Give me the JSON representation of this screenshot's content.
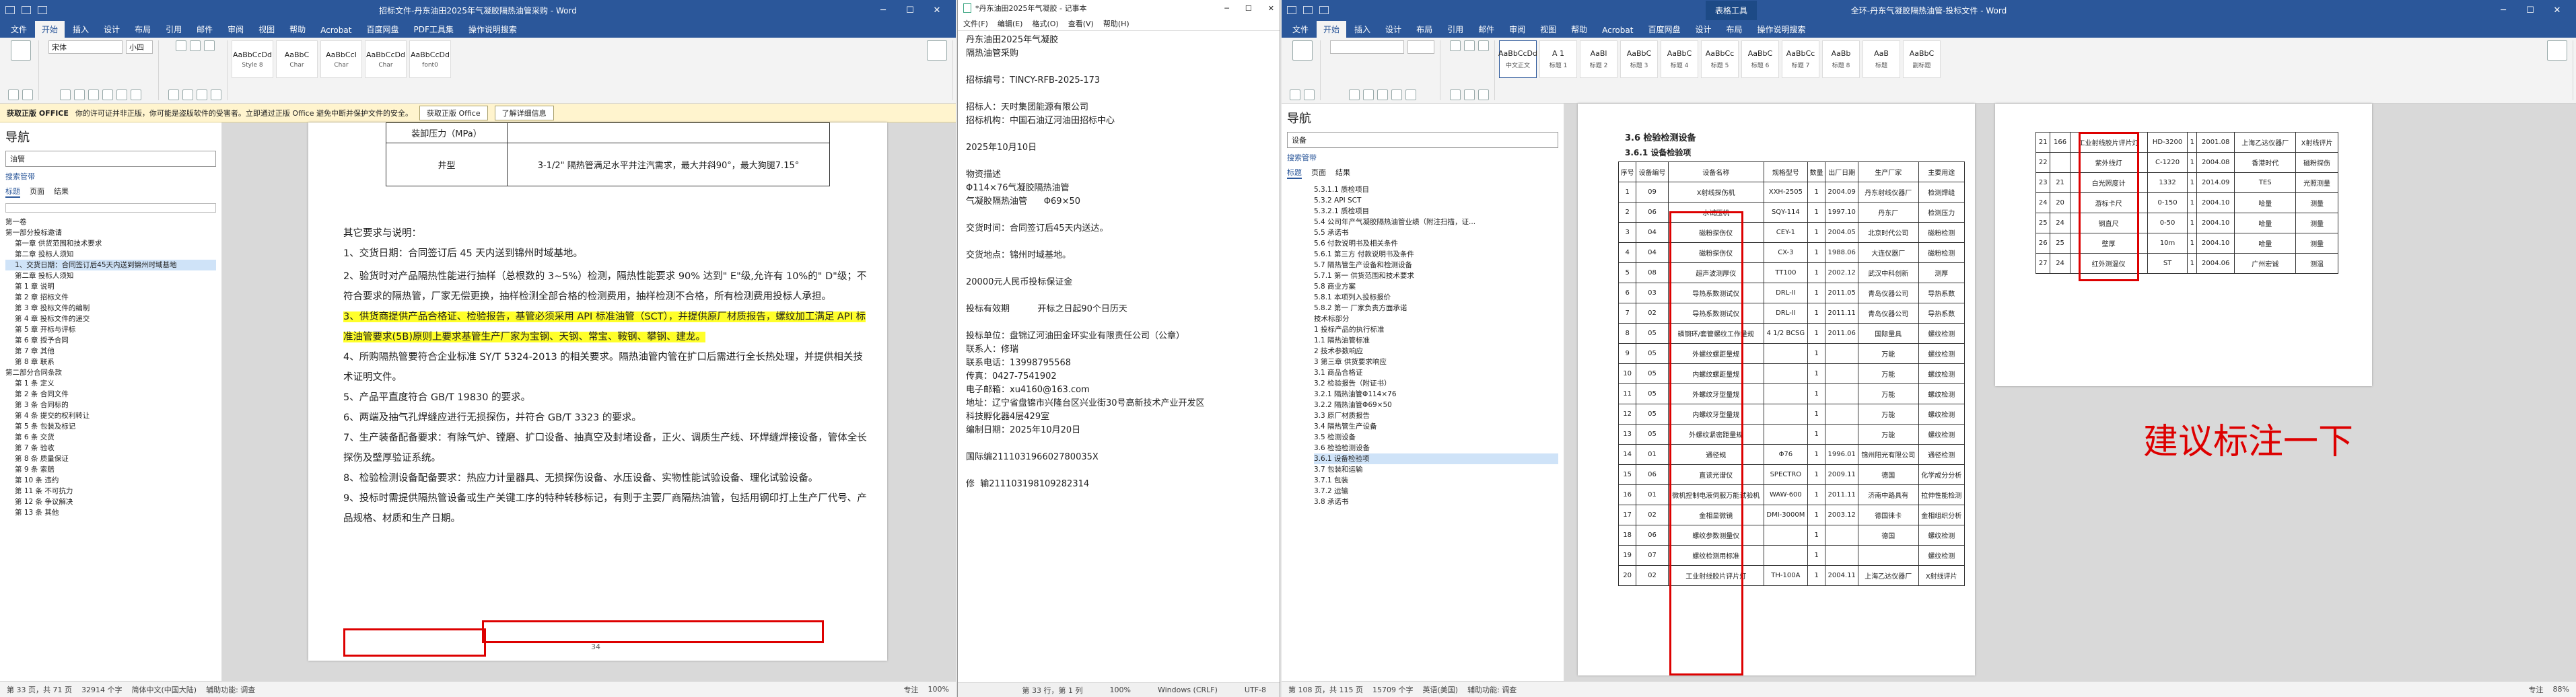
{
  "win1": {
    "title": "招标文件-丹东油田2025年气凝胶隔热油管采购 - Word",
    "tabs": [
      "文件",
      "开始",
      "插入",
      "设计",
      "布局",
      "引用",
      "邮件",
      "审阅",
      "视图",
      "帮助",
      "Acrobat",
      "百度网盘",
      "PDF工具集",
      "操作说明搜索"
    ],
    "font_name": "宋体",
    "font_size": "小四",
    "styles": [
      {
        "preview": "AaBbCcDd",
        "name": "Style 8"
      },
      {
        "preview": "AaBbC",
        "name": "Char"
      },
      {
        "preview": "AaBbCcI",
        "name": "Char"
      },
      {
        "preview": "AaBbCcDd",
        "name": "Char"
      },
      {
        "preview": "AaBbCcDd",
        "name": "font0"
      }
    ],
    "info_title": "获取正版 OFFICE",
    "info_text": "你的许可证并非正版，你可能是盗版软件的受害者。立即通过正版 Office 避免中断并保护文件的安全。",
    "info_btn1": "获取正版 Office",
    "info_btn2": "了解详细信息",
    "nav_title": "导航",
    "nav_search": "油管",
    "nav_result": "搜索管带",
    "nav_tabs": [
      "标题",
      "页面",
      "结果"
    ],
    "nav_items": [
      "第一卷",
      "第一部分投标邀请",
      "第一章 供货范围和技术要求",
      "第二章 投标人须知",
      "1、交货日期：合同签订后45天内送到锦州时域基地",
      "第二章 投标人须知",
      "第 1 章 说明",
      "第 2 章 招标文件",
      "第 3 章 投标文件的编制",
      "第 4 章 投标文件的递交",
      "第 5 章 开标与评标",
      "第 6 章 授予合同",
      "第 7 章 其他",
      "第 8 章 联系",
      "第二部分合同条款",
      "第 1 条 定义",
      "第 2 条 合同文件",
      "第 3 条 合同标的",
      "第 4 条 提交的权利转让",
      "第 5 条 包装及标记",
      "第 6 条 交货",
      "第 7 条 验收",
      "第 8 条 质量保证",
      "第 9 条 索赔",
      "第 10 条 违约",
      "第 11 条 不可抗力",
      "第 12 条 争议解决",
      "第 13 条 其他"
    ],
    "table_rows": [
      [
        "装卸压力（MPa）",
        ""
      ],
      [
        "井型",
        "3-1/2\" 隔热管满足水平井注汽需求，最大井斜90°，最大狗腿7.15°"
      ]
    ],
    "para_intro": "其它要求与说明：",
    "para1": "1、交货日期：合同签订后 45 天内送到锦州时域基地。",
    "para2": "2、验货时对产品隔热性能进行抽样（总根数的 3~5%）检测，隔热性能要求 90% 达到\" E\"级,允许有 10%的\" D\"级；不符合要求的隔热管，厂家无偿更换，抽样检测全部合格的检测费用，抽样检测不合格，所有检测费用投标人承担。",
    "para3": "3、供货商提供产品合格证、检验报告，基管必须采用 API 标准油管（SCT），并提供原厂材质报告，螺纹加工满足 API 标准油管要求(5B)原则上要求基管生产厂家为宝钢、天钢、常宝、鞍钢、攀钢、建龙。",
    "para4": "4、所购隔热管要符合企业标准 SY/T 5324-2013 的相关要求。隔热油管内管在扩口后需进行全长热处理，并提供相关技术证明文件。",
    "para5": "5、产品平直度符合 GB/T 19830 的要求。",
    "para6": "6、两端及抽气孔焊缝应进行无损探伤，并符合 GB/T 3323 的要求。",
    "para7": "7、生产装备配备要求：有除气炉、镗磨、扩口设备、抽真空及封堵设备，正火、调质生产线、环焊缝焊接设备，管体全长探伤及壁厚验证系统。",
    "para8": "8、检验检测设备配备要求：热应力计量器具、无损探伤设备、水压设备、实物性能试验设备、理化试验设备。",
    "para9": "9、投标时需提供隔热管设备或生产关键工序的特种转移标记，有则于主要厂商隔热油管，包括用钢印打上生产厂代号、产品规格、材质和生产日期。",
    "page_no": "34",
    "status": [
      "第 33 页，共 71 页",
      "32914 个字",
      "简体中文(中国大陆)",
      "辅助功能: 调查",
      "专注",
      "100%"
    ]
  },
  "notepad": {
    "title": "*丹东油田2025年气凝胶 - 记事本",
    "menu": [
      "文件(F)",
      "编辑(E)",
      "格式(O)",
      "查看(V)",
      "帮助(H)"
    ],
    "lines": [
      "丹东油田2025年气凝胶",
      "隔热油管采购",
      "",
      "招标编号：TINCY-RFB-2025-173",
      "",
      "招标人：天时集团能源有限公司",
      "招标机构：中国石油辽河油田招标中心",
      "",
      "2025年10月10日",
      "",
      "物资描述",
      "Φ114×76气凝胶隔热油管",
      "气凝胶隔热油管      Φ69×50",
      "",
      "交货时间：合同签订后45天内送达。",
      "",
      "交货地点：锦州时域基地。",
      "",
      "20000元人民币投标保证金",
      "",
      "投标有效期          开标之日起90个日历天",
      "",
      "投标单位：盘锦辽河油田金环实业有限责任公司（公章）",
      "联系人：修瑞",
      "联系电话：13998795568",
      "传真：0427-7541902",
      "电子邮箱：xu4160@163.com",
      "地址：辽宁省盘锦市兴隆台区兴业街30号高新技术产业开发区",
      "科技孵化器4层429室",
      "编制日期：2025年10月20日",
      "",
      "国际编211103196602780035X",
      "",
      "修  输211103198109282314"
    ],
    "status": [
      "第 33 行，第 1 列",
      "100%",
      "Windows (CRLF)",
      "UTF-8"
    ]
  },
  "win3": {
    "title": "全环-丹东气凝胶隔热油管-投标文件 - Word",
    "ctx_tab": "表格工具",
    "tabs": [
      "文件",
      "开始",
      "插入",
      "设计",
      "布局",
      "引用",
      "邮件",
      "审阅",
      "视图",
      "帮助",
      "Acrobat",
      "百度网盘",
      "设计",
      "布局",
      "操作说明搜索"
    ],
    "styles": [
      {
        "preview": "AaBbCcDd",
        "name": "中文正文"
      },
      {
        "preview": "A 1",
        "name": "标题 1"
      },
      {
        "preview": "AaBl",
        "name": "标题 2"
      },
      {
        "preview": "AaBbC",
        "name": "标题 3"
      },
      {
        "preview": "AaBbC",
        "name": "标题 4"
      },
      {
        "preview": "AaBbCc",
        "name": "标题 5"
      },
      {
        "preview": "AaBbC",
        "name": "标题 6"
      },
      {
        "preview": "AaBbCc",
        "name": "标题 7"
      },
      {
        "preview": "AaBb",
        "name": "标题 8"
      },
      {
        "preview": "AaB",
        "name": "标题"
      },
      {
        "preview": "AaBbC",
        "name": "副标题"
      }
    ],
    "nav_title": "导航",
    "nav_search": "设备",
    "nav_result": "搜索管带",
    "nav_tabs": [
      "标题",
      "页面",
      "结果"
    ],
    "nav_items": [
      "5.3.1.1 质检项目",
      "5.3.2 API SCT",
      "5.3.2.1 质检项目",
      "5.4 公司年产气凝胶隔热油管业绩（附注扫描，证...",
      "5.5 承诺书",
      "5.6 付款说明书及相关条件",
      "5.6.1 第三方 付款说明书及条件",
      "5.7 隔热管生产设备和检测设备",
      "5.7.1 第一 供货范围和技术要求",
      "5.8 商业方案",
      "5.8.1 本项列入投标报价",
      "5.8.2 第一 厂家负责方面承诺",
      "技术标部分",
      "1 投标产品的执行标准",
      "1.1 隔热油管标准",
      "2 技术参数响应",
      "3 第三章 供货要求响应",
      "3.1 商品合格证",
      "3.2 检验报告（附证书）",
      "3.2.1 隔热油管Φ114×76",
      "3.2.2 隔热油管Φ69×50",
      "3.3 原厂材质报告",
      "3.4 隔热管生产设备",
      "3.5 检测设备",
      "3.6 检验检测设备",
      "3.6.1 设备检验项",
      "3.7 包装和运输",
      "3.7.1 包装",
      "3.7.2 运输",
      "3.8 承诺书"
    ],
    "heading_main": "3.6 检验检测设备",
    "heading_sub": "3.6.1 设备检验项",
    "table_headers": [
      "序号",
      "设备编号",
      "设备名称",
      "规格型号",
      "数量",
      "出厂日期",
      "生产厂家",
      "主要用途"
    ],
    "table_rows": [
      [
        "1",
        "09",
        "X射线探伤机",
        "XXH-2505",
        "1",
        "2004.09",
        "丹东射线仪器厂",
        "检测焊缝"
      ],
      [
        "2",
        "06",
        "水试压机",
        "SQY-114",
        "1",
        "1997.10",
        "丹东厂",
        "检测压力"
      ],
      [
        "3",
        "04",
        "磁粉探伤仪",
        "CEY-1",
        "1",
        "2004.05",
        "北京时代公司",
        "磁粉检测"
      ],
      [
        "4",
        "04",
        "磁粉探伤仪",
        "CX-3",
        "1",
        "1988.06",
        "大连仪器厂",
        "磁粉检测"
      ],
      [
        "5",
        "08",
        "超声波测厚仪",
        "TT100",
        "1",
        "2002.12",
        "武汉中科创新",
        "测厚"
      ],
      [
        "6",
        "03",
        "导热系数测试仪",
        "DRL-II",
        "1",
        "2011.05",
        "青岛仪器公司",
        "导热系数"
      ],
      [
        "7",
        "02",
        "导热系数测试仪",
        "DRL-II",
        "1",
        "2011.11",
        "青岛仪器公司",
        "导热系数"
      ],
      [
        "8",
        "05",
        "磷钢环/套管螺纹工作量规",
        "4 1/2 BCSG",
        "1",
        "2011.06",
        "国际量具",
        "螺纹检测"
      ],
      [
        "9",
        "05",
        "外螺纹螺距量规",
        "",
        "1",
        "",
        "万能",
        "螺纹检测"
      ],
      [
        "10",
        "05",
        "内螺纹螺距量规",
        "",
        "1",
        "",
        "万能",
        "螺纹检测"
      ],
      [
        "11",
        "05",
        "外螺纹牙型量规",
        "",
        "1",
        "",
        "万能",
        "螺纹检测"
      ],
      [
        "12",
        "05",
        "内螺纹牙型量规",
        "",
        "1",
        "",
        "万能",
        "螺纹检测"
      ],
      [
        "13",
        "05",
        "外螺纹紧密距量规",
        "",
        "1",
        "",
        "万能",
        "螺纹检测"
      ],
      [
        "14",
        "01",
        "通径规",
        "Φ76",
        "1",
        "1996.01",
        "锦州阳光有限公司",
        "通径检测"
      ],
      [
        "15",
        "06",
        "直读光谱仪",
        "SPECTRO",
        "1",
        "2009.11",
        "德国",
        "化学成分分析"
      ],
      [
        "16",
        "01",
        "微机控制电液伺服万能试验机",
        "WAW-600",
        "1",
        "2011.11",
        "济南中路具有",
        "拉伸性能检测"
      ],
      [
        "17",
        "02",
        "金相显微镜",
        "DMI-3000M",
        "1",
        "2003.12",
        "德国徕卡",
        "金相组织分析"
      ],
      [
        "18",
        "06",
        "螺纹参数测量仪",
        "",
        "1",
        "",
        "德国",
        "螺纹检测"
      ],
      [
        "19",
        "07",
        "螺纹检测用标准",
        "",
        "1",
        "",
        "",
        "螺纹检测"
      ],
      [
        "20",
        "02",
        "工业射线胶片评片灯",
        "TH-100A",
        "1",
        "2004.11",
        "上海乙达仪器厂",
        "X射线评片"
      ]
    ],
    "table2_rows": [
      [
        "21",
        "166",
        "工业射线胶片评片灯",
        "HD-3200",
        "1",
        "2001.08",
        "上海乙达仪器厂",
        "X射线评片"
      ],
      [
        "22",
        "",
        "紫外线灯",
        "C-1220",
        "1",
        "2004.08",
        "香港时代",
        "磁粉探伤"
      ],
      [
        "23",
        "21",
        "白光照度计",
        "1332",
        "1",
        "2014.09",
        "TES",
        "光照测量"
      ],
      [
        "24",
        "20",
        "游标卡尺",
        "0-150",
        "1",
        "2004.10",
        "哈量",
        "测量"
      ],
      [
        "25",
        "24",
        "钢直尺",
        "0-50",
        "1",
        "2004.10",
        "哈量",
        "测量"
      ],
      [
        "26",
        "25",
        "壁厚",
        "10m",
        "1",
        "2004.10",
        "哈量",
        "测量"
      ],
      [
        "27",
        "24",
        "红外测温仪",
        "ST",
        "1",
        "2004.06",
        "广州宏诚",
        "测温"
      ]
    ],
    "annotation": "建议标注一下",
    "status": [
      "第 108 页，共 115 页",
      "15709 个字",
      "英语(美国)",
      "辅助功能: 调查",
      "专注",
      "88%"
    ]
  },
  "colors": {
    "word_blue": "#2b579a",
    "highlight_yellow": "#ffff2b",
    "red": "#dd0000"
  }
}
